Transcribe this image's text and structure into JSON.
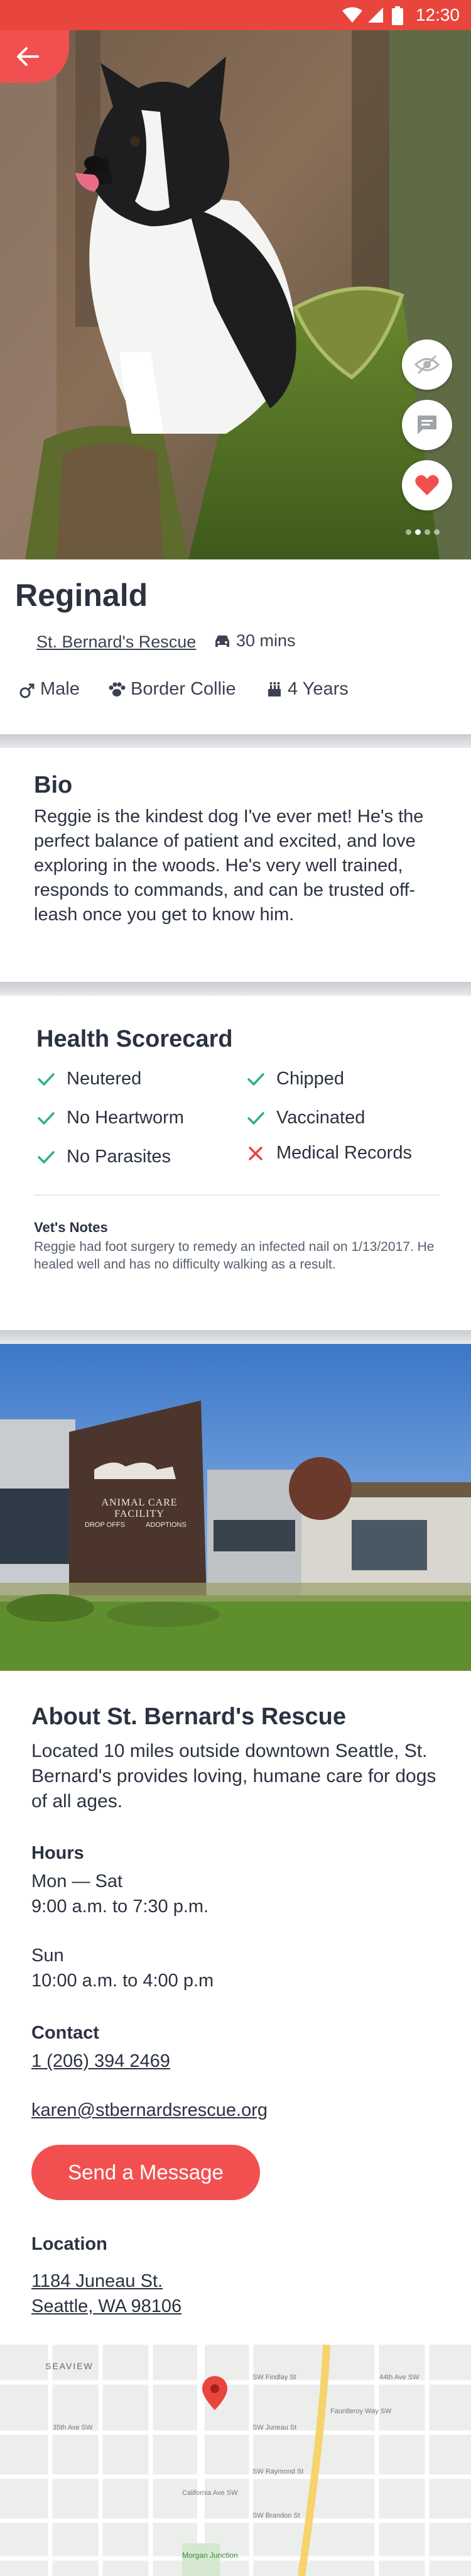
{
  "status_bar": {
    "time": "12:30"
  },
  "profile": {
    "name": "Reginald",
    "shelter": "St. Bernard's Rescue",
    "distance": "30 mins",
    "gender": "Male",
    "breed": "Border Collie",
    "age": "4 Years"
  },
  "bio": {
    "title": "Bio",
    "text": "Reggie is the kindest dog I've ever met! He's the perfect balance of patient and excited, and love exploring in the woods. He's very well trained, responds to commands, and can be trusted off-leash once you get to know him."
  },
  "health": {
    "title": "Health Scorecard",
    "items": [
      {
        "label": "Neutered",
        "ok": true
      },
      {
        "label": "Chipped",
        "ok": true
      },
      {
        "label": "No Heartworm",
        "ok": true
      },
      {
        "label": "Vaccinated",
        "ok": true
      },
      {
        "label": "No Parasites",
        "ok": true
      },
      {
        "label": "Medical Records",
        "ok": false
      }
    ],
    "vets_notes_title": "Vet's Notes",
    "vets_notes": "Reggie had foot surgery to remedy an infected nail on 1/13/2017. He healed well and has no difficulty walking as a result."
  },
  "facility_sign": {
    "line1": "ANIMAL CARE FACILITY",
    "drop_offs": "DROP OFFS",
    "adoptions": "ADOPTIONS"
  },
  "about": {
    "title": "About St. Bernard's Rescue",
    "text": "Located 10 miles outside downtown Seattle, St. Bernard's provides loving, humane care for dogs of all ages.",
    "hours_title": "Hours",
    "hours_weekday_days": "Mon — Sat",
    "hours_weekday_time": "9:00 a.m. to 7:30 p.m.",
    "hours_sun_day": "Sun",
    "hours_sun_time": "10:00 a.m. to 4:00 p.m",
    "contact_title": "Contact",
    "phone": "1 (206) 394 2469",
    "email": "karen@stbernardsrescue.org",
    "send_button": "Send a Message",
    "location_title": "Location",
    "address_line1": "1184 Juneau St.",
    "address_line2": "Seattle, WA 98106"
  },
  "map": {
    "neighborhood": "SEAVIEW",
    "station": "Morgan Junction",
    "streets": [
      "SW Findlay St",
      "SW Juneau St",
      "SW Raymond St",
      "SW Brandon St",
      "California Ave SW",
      "Fauntleroy Way SW",
      "44th Ave SW",
      "35th Ave SW"
    ]
  },
  "colors": {
    "accent": "#f25050",
    "check": "#2fb37a",
    "cross": "#e8453c",
    "text": "#2b3240"
  }
}
